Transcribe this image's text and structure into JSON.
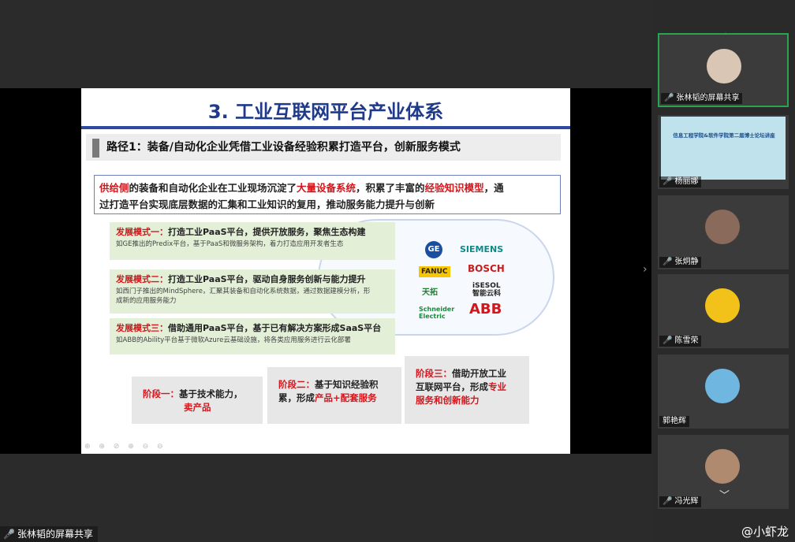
{
  "colors": {
    "title_blue": "#1f3a8a",
    "highlight_red": "#d3161c",
    "active_green": "#27a64f",
    "mode_green": "#e3efd6"
  },
  "slide": {
    "title": "3. 工业互联网平台产业体系",
    "route": "路径1：装备/自动化企业凭借工业设备经验积累打造平台，创新服务模式",
    "supply": {
      "l1_a": "供给侧",
      "l1_b": "的装备和自动化企业在工业现场沉淀了",
      "l1_c": "大量设备系统",
      "l1_d": "，积累了丰富的",
      "l1_e": "经验知识模型",
      "l1_f": "，通",
      "l2": "过打造平台实现底层数据的汇集和工业知识的复用，推动服务能力提升与创新"
    },
    "modes": [
      {
        "label": "发展模式一：",
        "title": "打造工业PaaS平台，提供开放服务，聚焦生态构建",
        "desc": "如GE推出的Predix平台，基于PaaS和微服务架构，着力打造应用开发者生态"
      },
      {
        "label": "发展模式二：",
        "title": "打造工业PaaS平台，驱动自身服务创新与能力提升",
        "desc": "如西门子推出的MindSphere，汇聚其装备和自动化系统数据，通过数据建模分析，形成新的应用服务能力"
      },
      {
        "label": "发展模式三：",
        "title": "借助通用PaaS平台，基于已有解决方案形成SaaS平台",
        "desc": "如ABB的Ability平台基于微软Azure云基础设施，将各类应用服务进行云化部署"
      }
    ],
    "watermark": "平台",
    "logos": {
      "ge": "GE",
      "siemens": "SIEMENS",
      "fanuc": "FANUC",
      "bosch": "BOSCH",
      "tianfang": "天拓",
      "isesol": "iSESOL",
      "isesol_sub": "智能云科",
      "schneider": "Schneider",
      "schneider_sub": "Electric",
      "abb": "ABB"
    },
    "stages": [
      {
        "label": "阶段一：",
        "a": "基于技术能力，",
        "b": "卖产品"
      },
      {
        "label": "阶段二：",
        "a": "基于知识经验积",
        "b": "累，形成",
        "c": "产品+配套服务"
      },
      {
        "label": "阶段三：",
        "a": "借助开放工业",
        "b": "互联网平台，形成",
        "c": "专业",
        "d": "服务和创新能力"
      }
    ],
    "tools": "⊕ ⊕ ⊘ ⊕ ⊖ ⊖"
  },
  "share_label": "张林韬的屏幕共享",
  "participants": [
    {
      "name": "张林韬的屏幕共享",
      "type": "avatar",
      "active": true
    },
    {
      "name": "杨丽娜",
      "type": "screen",
      "thumb_title": "信息工程学院&软件学院第二届博士论坛讲座"
    },
    {
      "name": "张炯静",
      "type": "avatar"
    },
    {
      "name": "陈雪荣",
      "type": "avatar"
    },
    {
      "name": "郭艳辉",
      "type": "avatar"
    },
    {
      "name": "冯光辉",
      "type": "avatar"
    }
  ],
  "watermark_text": "@小虾龙"
}
